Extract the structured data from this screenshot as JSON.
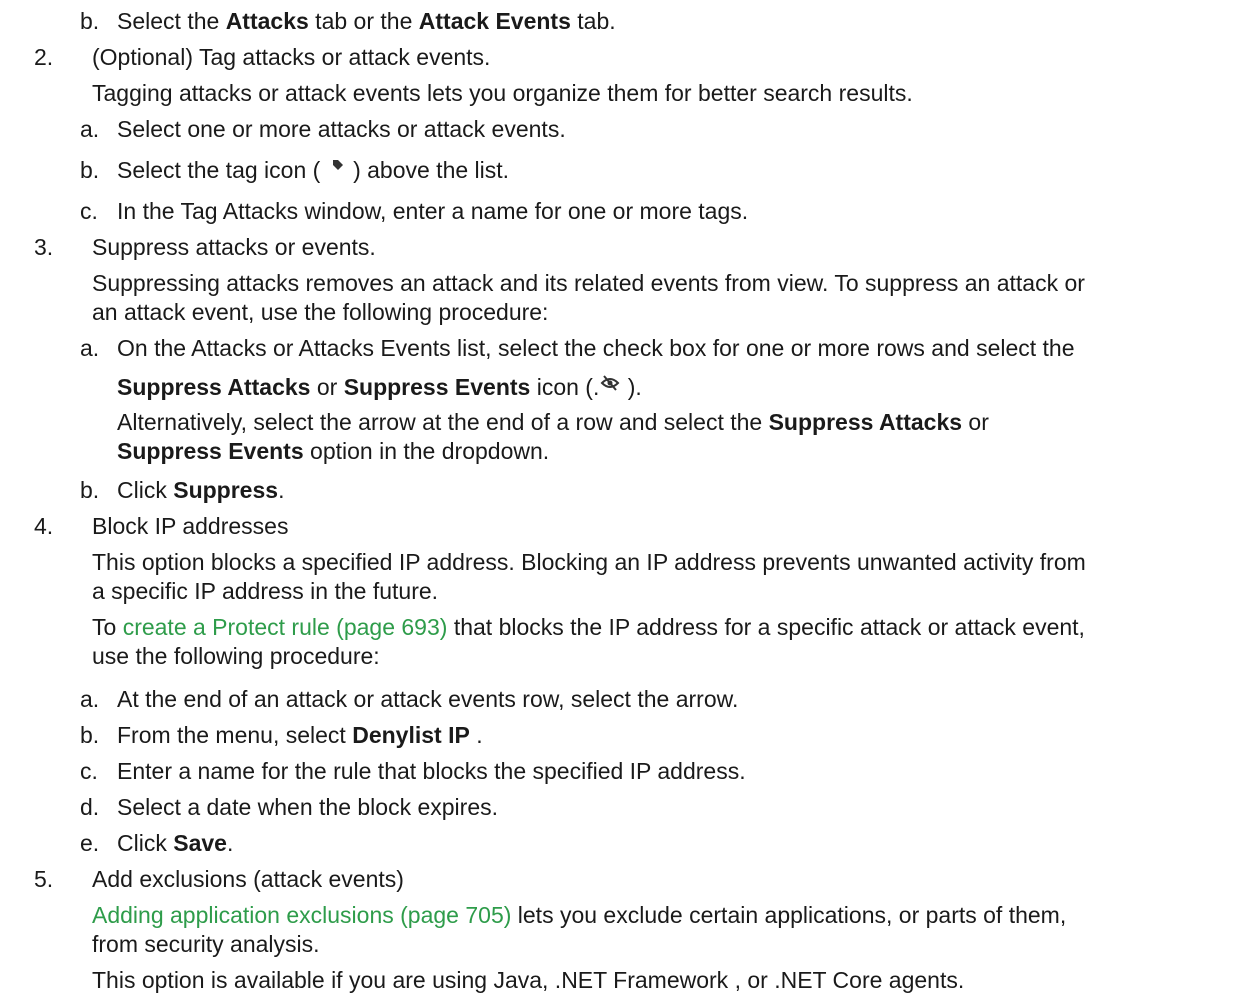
{
  "colors": {
    "text": "#1a1a1a",
    "link": "#2e9c4a"
  },
  "lines": {
    "l0": {
      "marker": "b.",
      "pre": "Select the ",
      "b1": "Attacks",
      "mid": " tab or the ",
      "b2": "Attack Events",
      "post": " tab."
    },
    "l1": {
      "marker": "2.",
      "text": "(Optional) Tag attacks or attack events."
    },
    "l2": {
      "text": "Tagging attacks or attack events lets you organize them for better search results."
    },
    "l3": {
      "marker": "a.",
      "text": "Select one or more attacks or attack events."
    },
    "l4": {
      "marker": "b.",
      "pre": "Select the tag icon ( ",
      "post": " ) above the list.",
      "icon": "tag-icon"
    },
    "l5": {
      "marker": "c.",
      "text": "In the Tag Attacks window, enter a name for one or more tags."
    },
    "l6": {
      "marker": "3.",
      "text": "Suppress attacks or events."
    },
    "l7": {
      "text": "Suppressing attacks removes an attack and its related events from view. To suppress an attack or"
    },
    "l8": {
      "text": "an attack event, use the following procedure:"
    },
    "l9": {
      "marker": "a.",
      "text": "On the Attacks or Attacks Events list, select the check box for one or more rows and select the"
    },
    "l10": {
      "b1": "Suppress Attacks",
      "mid": " or ",
      "b2": "Suppress Events",
      "pre": " icon (.",
      "post": " ).",
      "icon": "eye-off-icon"
    },
    "l11": {
      "pre": "Alternatively, select the arrow at the end of a row and select the ",
      "b1": "Suppress Attacks",
      "post": " or"
    },
    "l12": {
      "b1": "Suppress Events",
      "post": " option in the dropdown."
    },
    "l13": {
      "marker": "b.",
      "pre": "Click ",
      "b1": "Suppress",
      "post": "."
    },
    "l14": {
      "marker": "4.",
      "text": "Block IP addresses"
    },
    "l15": {
      "text": "This option blocks a specified IP address. Blocking an IP address prevents unwanted activity from"
    },
    "l16": {
      "text": "a specific IP address in the future."
    },
    "l17": {
      "pre": "To ",
      "link": "create a Protect rule (page 693)",
      "post": " that blocks the IP address for a specific attack or attack event,"
    },
    "l18": {
      "text": "use the following procedure:"
    },
    "l19": {
      "marker": "a.",
      "text": "At the end of an attack or attack events row, select the arrow."
    },
    "l20": {
      "marker": "b.",
      "pre": "From the menu, select ",
      "b1": "Denylist IP",
      "post": " ."
    },
    "l21": {
      "marker": "c.",
      "text": "Enter a name for the rule that blocks the specified IP address."
    },
    "l22": {
      "marker": "d.",
      "text": "Select a date when the block expires."
    },
    "l23": {
      "marker": "e.",
      "pre": "Click ",
      "b1": "Save",
      "post": "."
    },
    "l24": {
      "marker": "5.",
      "text": "Add exclusions (attack events)"
    },
    "l25": {
      "link": "Adding application exclusions (page 705)",
      "post": " lets you exclude certain applications, or parts of them,"
    },
    "l26": {
      "text": "from security analysis."
    },
    "l27": {
      "text": "This option is available if you are using Java, .NET Framework , or .NET Core agents."
    }
  }
}
